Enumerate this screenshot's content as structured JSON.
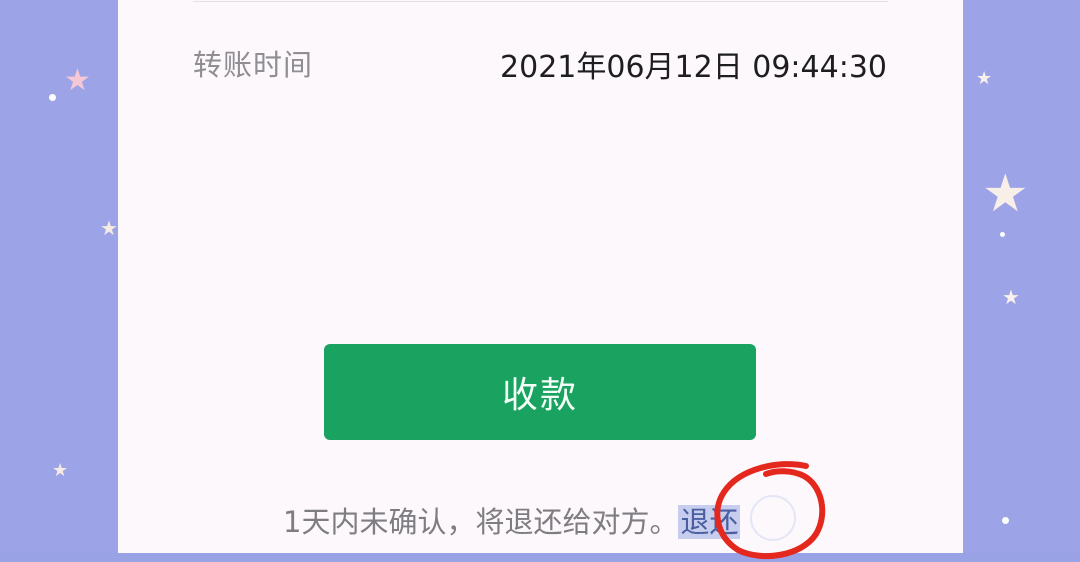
{
  "transfer": {
    "time_label": "转账时间",
    "time_value": "2021年06月12日 09:44:30"
  },
  "actions": {
    "receive_label": "收款"
  },
  "notice": {
    "text": "1天内未确认，将退还给对方。",
    "return_link": "退还"
  },
  "colors": {
    "primary_button": "#1aa260",
    "annotation_circle": "#e5281e",
    "background": "#9aa2e6"
  }
}
